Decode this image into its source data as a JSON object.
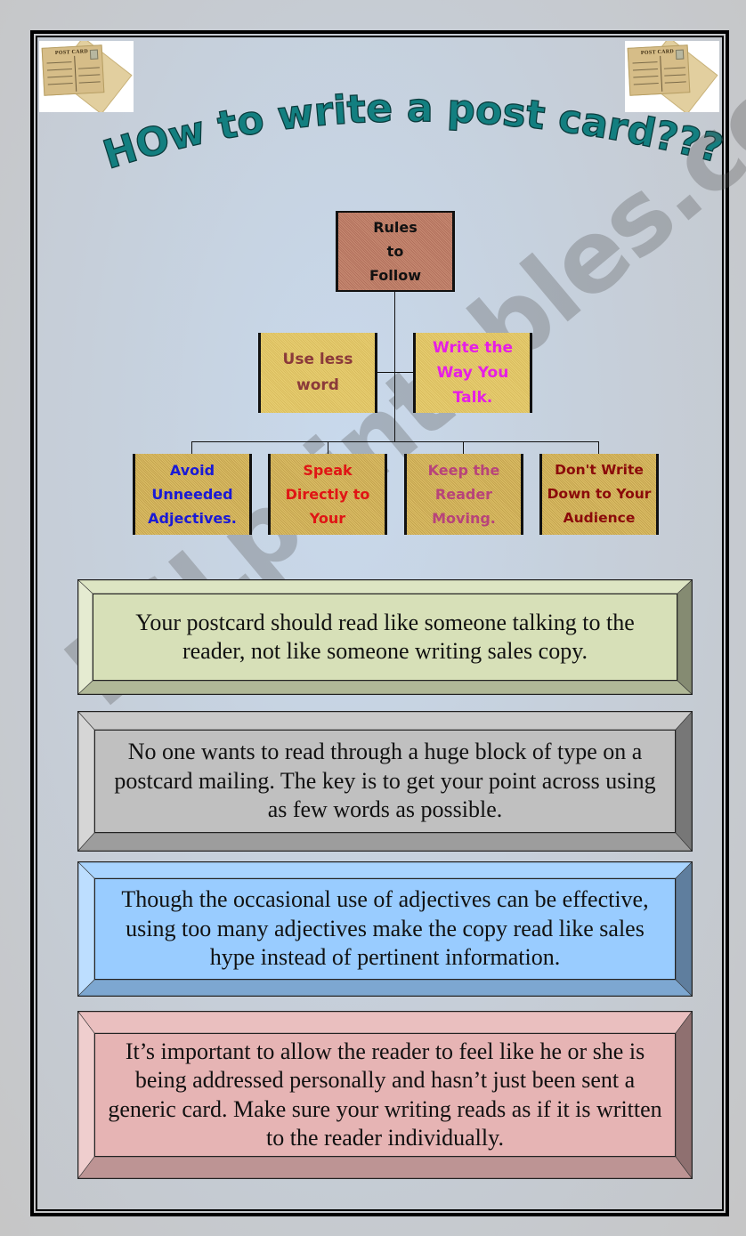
{
  "page": {
    "title": "HOw to write a post card???",
    "watermark": "ESLprintables.com"
  },
  "images": {
    "postcard_left": {
      "label": "POST CARD",
      "alt": "postcard-image"
    },
    "postcard_right": {
      "label": "POST CARD",
      "alt": "postcard-image"
    }
  },
  "org_chart": {
    "root": {
      "lines": [
        "Rules",
        "to",
        "Follow"
      ],
      "color": "#111111"
    },
    "level1": [
      {
        "lines": [
          "Use less",
          "word"
        ],
        "color": "#8b3a3a"
      },
      {
        "lines": [
          "Write the",
          "Way You",
          "Talk."
        ],
        "color": "#e61ee6"
      }
    ],
    "level2": [
      {
        "lines": [
          "Avoid",
          "Unneeded",
          "Adjectives."
        ],
        "color": "#1a1ad6"
      },
      {
        "lines": [
          "Speak",
          "Directly to",
          "Your"
        ],
        "color": "#e01515"
      },
      {
        "lines": [
          "Keep the",
          "Reader",
          "Moving."
        ],
        "color": "#b8437a"
      },
      {
        "lines": [
          "Don't Write",
          "Down to Your",
          "Audience"
        ],
        "color": "#8b0a0a"
      }
    ]
  },
  "tips": [
    {
      "text": "Your postcard should read like someone talking to the reader, not like someone writing sales copy.",
      "face_color": "#d7e0b8"
    },
    {
      "text": "No one wants to read through a huge block of type on a postcard mailing. The key is to get your point across using as few words as possible.",
      "face_color": "#c0c0c0"
    },
    {
      "text": "Though the occasional use of adjectives can be effective, using too many adjectives make the copy read like sales hype instead of pertinent information.",
      "face_color": "#99ccff"
    },
    {
      "text": "It’s important to allow the reader to feel like he or she is being addressed personally and hasn’t just been sent a generic card.  Make sure your writing reads as if it is written to the reader individually.",
      "face_color": "#e6b4b4"
    }
  ]
}
